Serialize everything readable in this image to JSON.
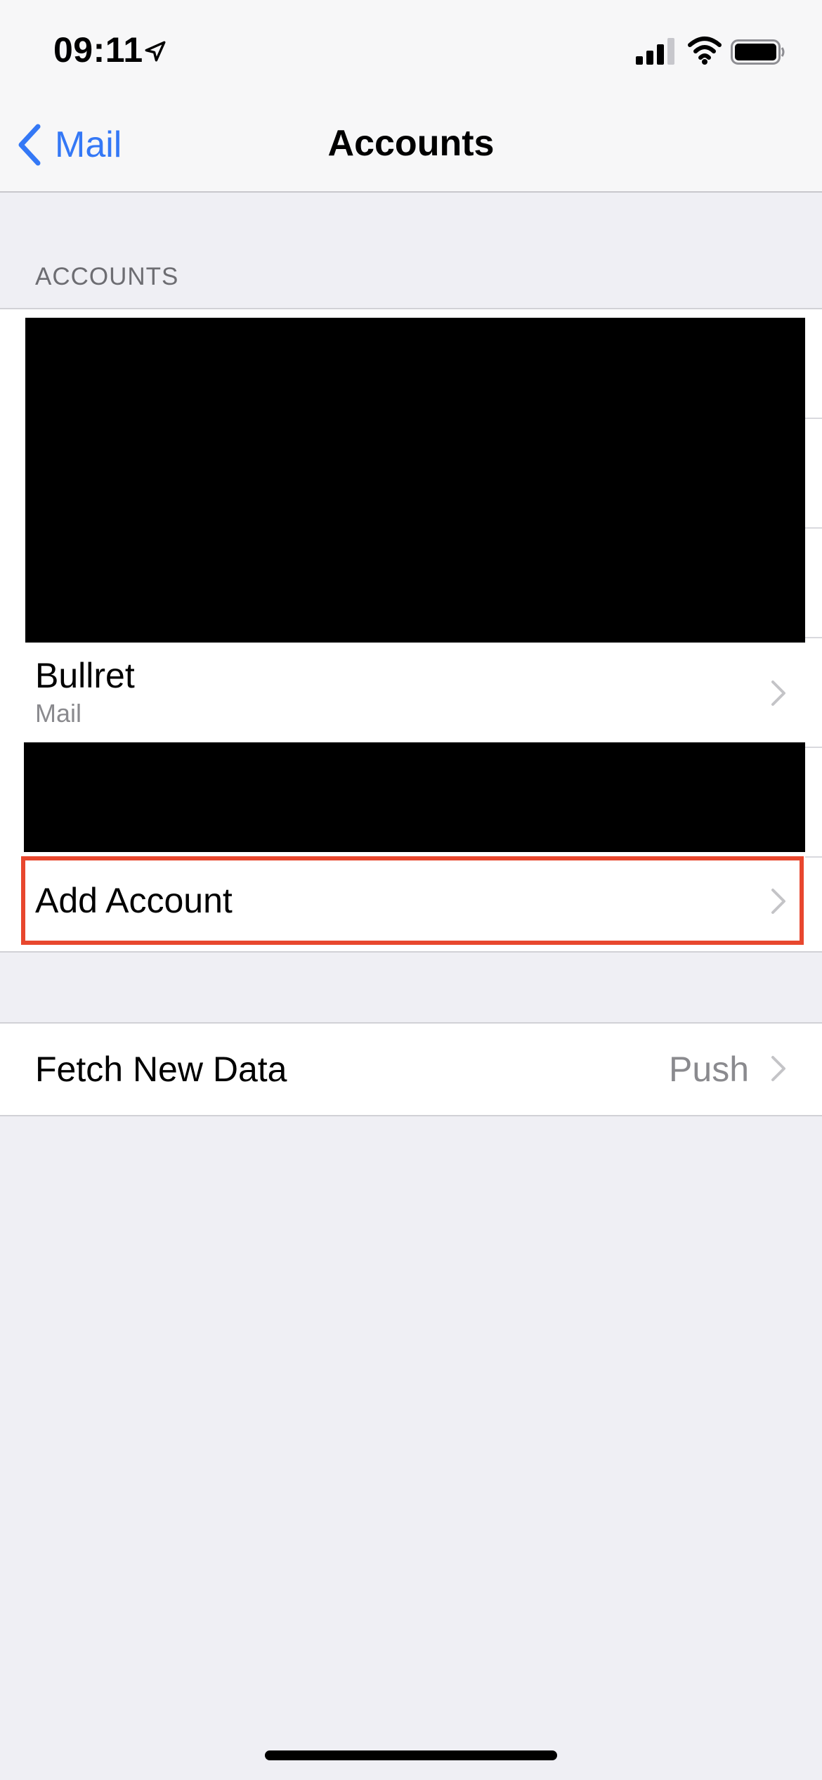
{
  "status_bar": {
    "time": "09:11",
    "icons": [
      "location-arrow-icon",
      "cellular-signal-icon",
      "wifi-icon",
      "battery-icon"
    ]
  },
  "nav": {
    "back_label": "Mail",
    "title": "Accounts",
    "accent_color": "#3478f6"
  },
  "accounts_section": {
    "header": "ACCOUNTS",
    "items": [
      {
        "title": "Bullret",
        "subtitle": "Mail"
      }
    ],
    "add_account_label": "Add Account",
    "highlight_color": "#e8472e"
  },
  "fetch": {
    "label": "Fetch New Data",
    "value": "Push"
  }
}
